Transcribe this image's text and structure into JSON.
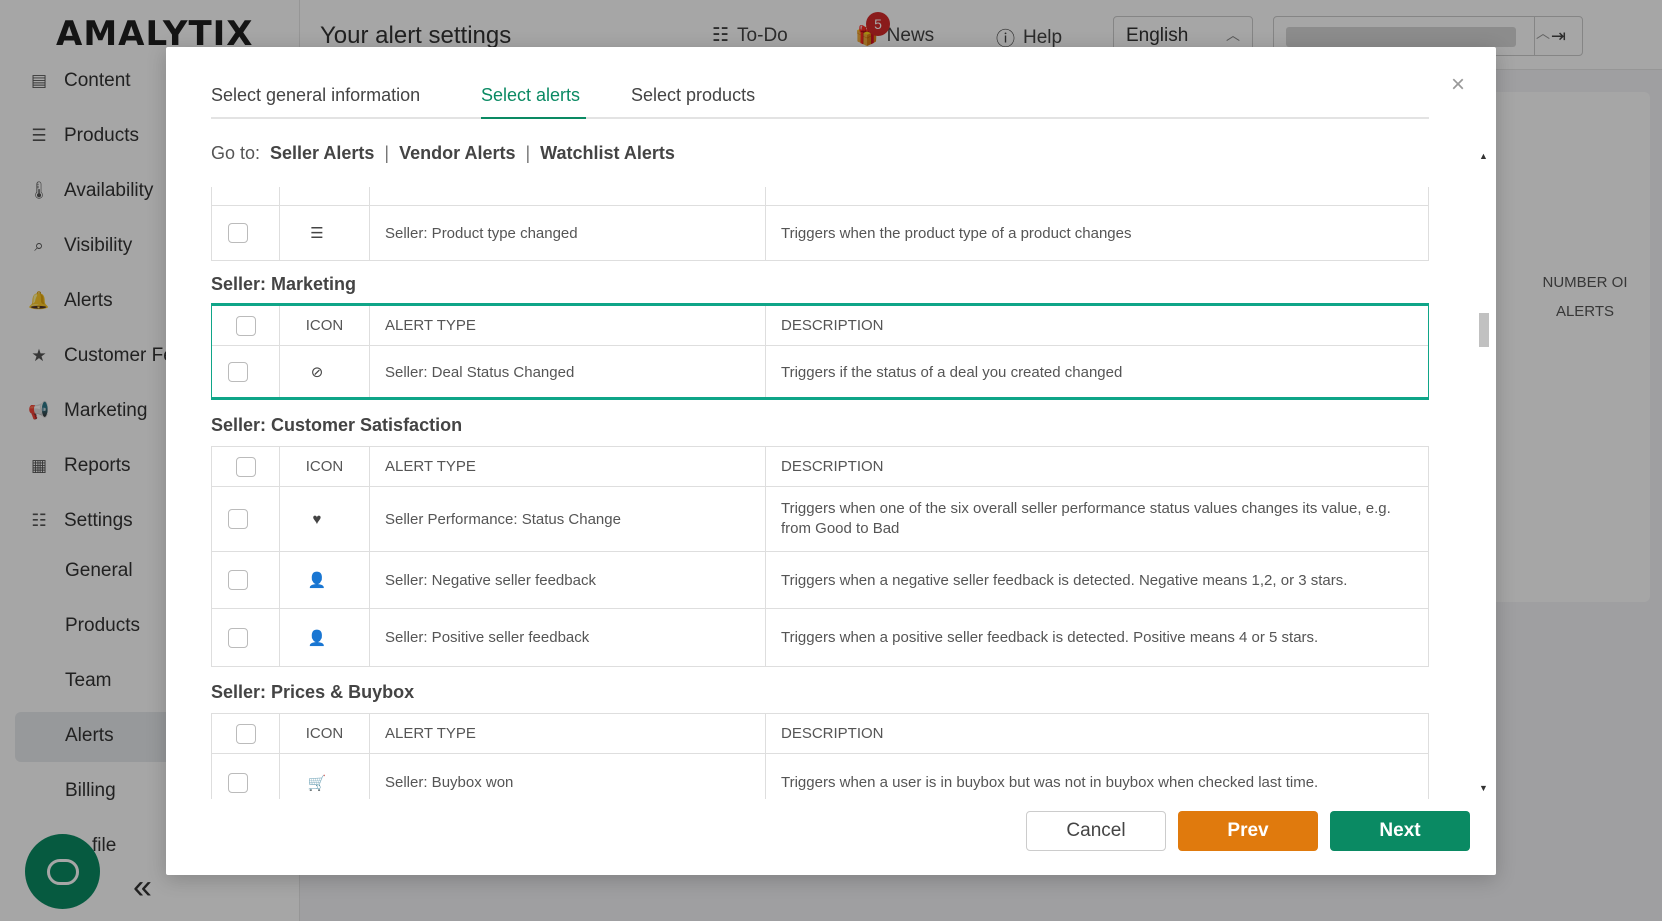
{
  "app": {
    "logo": "AMALYTIX",
    "page_title": "Your alert settings",
    "top_links": {
      "todo": "To-Do",
      "news": "News",
      "news_badge": "5",
      "help": "Help"
    },
    "language": "English",
    "sidebar": {
      "items": [
        {
          "label": "Content",
          "icon": "content-icon"
        },
        {
          "label": "Products",
          "icon": "list-icon"
        },
        {
          "label": "Availability",
          "icon": "thermometer-icon"
        },
        {
          "label": "Visibility",
          "icon": "search-icon"
        },
        {
          "label": "Alerts",
          "icon": "bell-icon"
        },
        {
          "label": "Customer Fe",
          "icon": "star-icon"
        },
        {
          "label": "Marketing",
          "icon": "megaphone-icon"
        },
        {
          "label": "Reports",
          "icon": "table-icon"
        },
        {
          "label": "Settings",
          "icon": "sliders-icon"
        }
      ],
      "sub_items": [
        "General",
        "Products",
        "Team",
        "Alerts",
        "Billing",
        "file"
      ]
    },
    "bg_table": {
      "col_header_1": "NUMBER OI",
      "col_header_2": "ALERTS"
    }
  },
  "modal": {
    "tabs": [
      "Select general information",
      "Select alerts",
      "Select products"
    ],
    "active_tab": "Select alerts",
    "goto_label": "Go to:",
    "goto_links": [
      "Seller Alerts",
      "Vendor Alerts",
      "Watchlist Alerts"
    ],
    "columns": {
      "icon": "ICON",
      "alert_type": "ALERT TYPE",
      "description": "DESCRIPTION"
    },
    "prev_section_last_row": {
      "alert_type": "Seller: Product type changed",
      "description": "Triggers when the product type of a product changes",
      "icon": "list-check-icon"
    },
    "sections": [
      {
        "title": "Seller: Marketing",
        "rows": [
          {
            "alert_type": "Seller: Deal Status Changed",
            "description": "Triggers if the status of a deal you created changed",
            "icon": "ban-icon"
          }
        ]
      },
      {
        "title": "Seller: Customer Satisfaction",
        "rows": [
          {
            "alert_type": "Seller Performance: Status Change",
            "description": "Triggers when one of the six overall seller performance status values changes its value, e.g. from Good to Bad",
            "icon": "heart-pulse-icon"
          },
          {
            "alert_type": "Seller: Negative seller feedback",
            "description": "Triggers when a negative seller feedback is detected. Negative means 1,2, or 3 stars.",
            "icon": "user-x-icon"
          },
          {
            "alert_type": "Seller: Positive seller feedback",
            "description": "Triggers when a positive seller feedback is detected. Positive means 4 or 5 stars.",
            "icon": "user-plus-icon"
          }
        ]
      },
      {
        "title": "Seller: Prices & Buybox",
        "rows": [
          {
            "alert_type": "Seller: Buybox won",
            "description": "Triggers when a user is in buybox but was not in buybox when checked last time.",
            "icon": "cart-icon"
          }
        ]
      }
    ],
    "buttons": {
      "cancel": "Cancel",
      "prev": "Prev",
      "next": "Next"
    },
    "colors": {
      "accent": "#0a8a63",
      "highlight": "#0fa588",
      "prev": "#e07a0d"
    }
  }
}
